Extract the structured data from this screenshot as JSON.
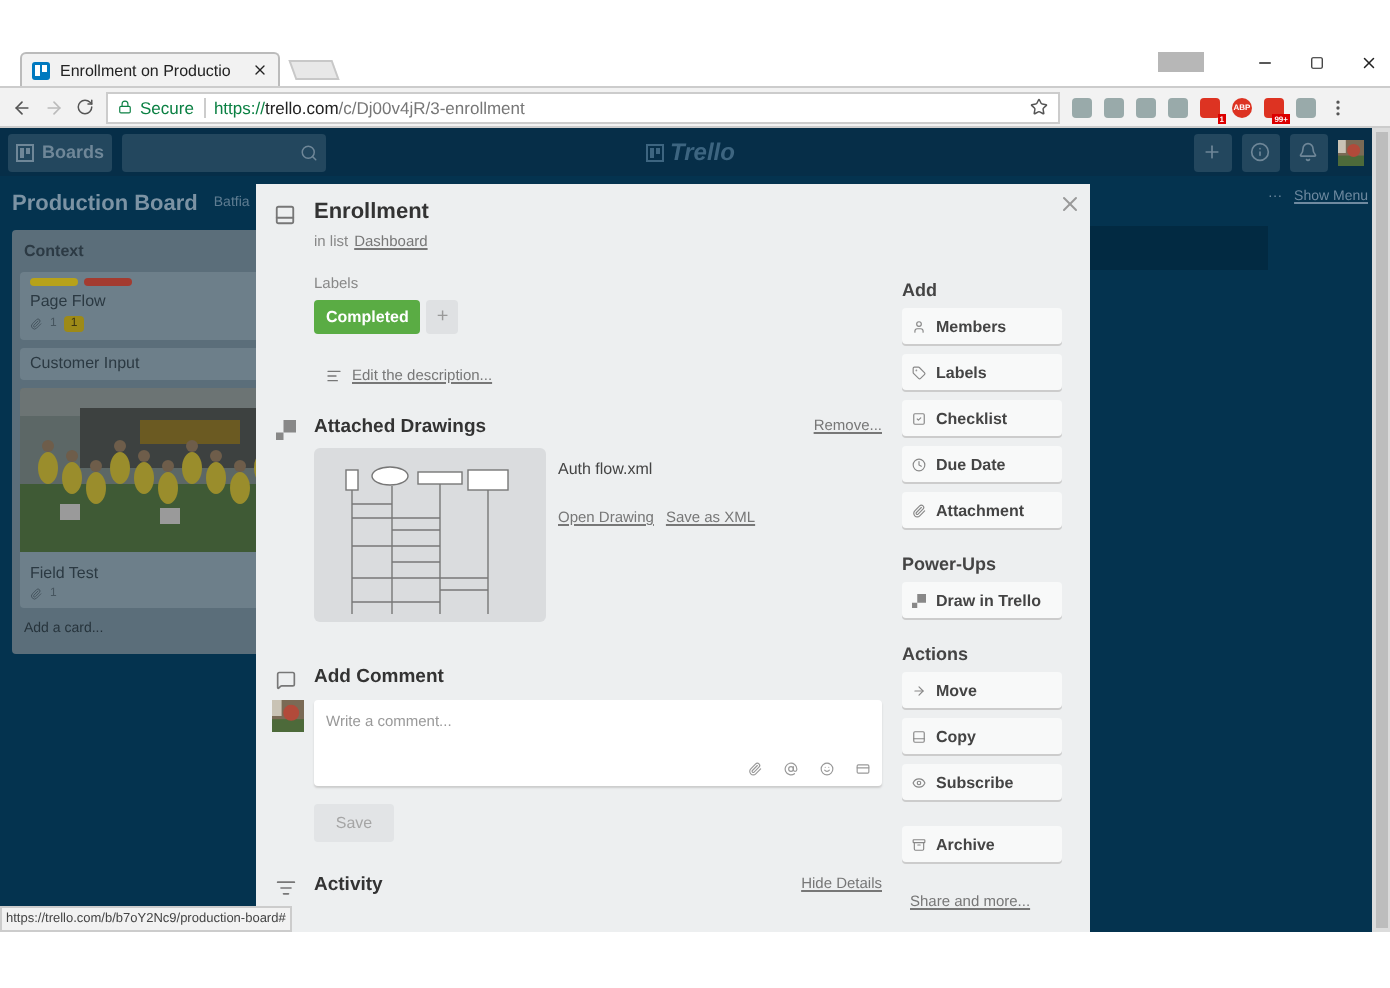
{
  "browser": {
    "tabs": [
      {
        "title": "Enrollment on Productio",
        "selected": true
      }
    ],
    "security": "Secure",
    "url_scheme": "https://",
    "url_host": "trello.com",
    "url_path": "/c/Dj00v4jR/3-enrollment",
    "extensions": [
      {
        "kind": "plain"
      },
      {
        "kind": "plain"
      },
      {
        "kind": "plain"
      },
      {
        "kind": "plain"
      },
      {
        "kind": "badge",
        "text": "1"
      },
      {
        "kind": "abp",
        "text": "ABP"
      },
      {
        "kind": "badge",
        "text": "99+"
      },
      {
        "kind": "plain"
      }
    ],
    "status_url": "https://trello.com/b/b7oY2Nc9/production-board#"
  },
  "header": {
    "boards": "Boards",
    "logo": "Trello"
  },
  "board": {
    "title": "Production Board",
    "team": "Batfia",
    "menu_dots": "···",
    "show_menu": "Show Menu"
  },
  "list": {
    "title": "Context",
    "add_card": "Add a card...",
    "cards": [
      {
        "title": "Page Flow",
        "labels": [
          {
            "color": "#b7a21a"
          },
          {
            "color": "#a33b30"
          }
        ],
        "attachments": "1",
        "drawings": "1"
      },
      {
        "title": "Customer Input"
      },
      {
        "title": "Field Test",
        "attachments": "1"
      }
    ]
  },
  "card_detail": {
    "title": "Enrollment",
    "in_list_prefix": "in list",
    "list_name": "Dashboard",
    "labels_heading": "Labels",
    "labels": [
      {
        "text": "Completed",
        "color": "#5aac44"
      }
    ],
    "add_label": "+",
    "description_link": "Edit the description...",
    "drawings_heading": "Attached Drawings",
    "remove": "Remove...",
    "drawing": {
      "file": "Auth flow.xml",
      "open": "Open Drawing",
      "save": "Save as XML"
    },
    "comment_heading": "Add Comment",
    "comment_placeholder": "Write a comment...",
    "save": "Save",
    "save_disabled": true,
    "activity_heading": "Activity",
    "hide_details": "Hide Details"
  },
  "sidebar": {
    "sections": [
      {
        "heading": "Add",
        "buttons": [
          {
            "label": "Members",
            "kind": "user"
          },
          {
            "label": "Labels",
            "kind": "tag"
          },
          {
            "label": "Checklist",
            "kind": "check"
          },
          {
            "label": "Due Date",
            "kind": "clock"
          },
          {
            "label": "Attachment",
            "kind": "clip"
          }
        ]
      },
      {
        "heading": "Power-Ups",
        "buttons": [
          {
            "label": "Draw in Trello",
            "kind": "draw"
          }
        ]
      },
      {
        "heading": "Actions",
        "buttons": [
          {
            "label": "Move",
            "kind": "arrow"
          },
          {
            "label": "Copy",
            "kind": "card"
          },
          {
            "label": "Subscribe",
            "kind": "eye"
          },
          {
            "label": "Archive",
            "kind": "archive"
          }
        ]
      }
    ],
    "share": "Share and more..."
  }
}
